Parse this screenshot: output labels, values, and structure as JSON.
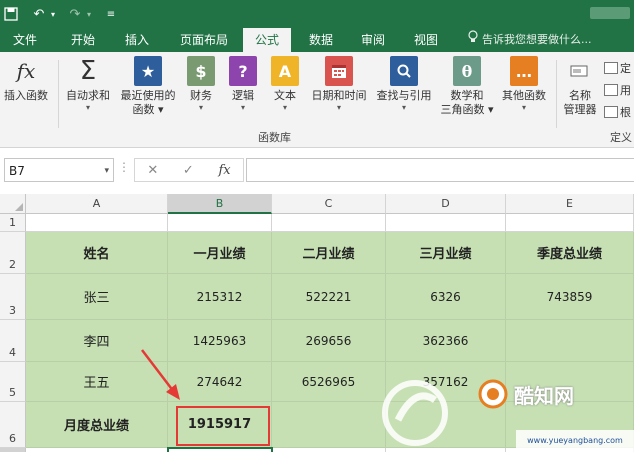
{
  "ribbon": {
    "tabs": [
      "文件",
      "开始",
      "插入",
      "页面布局",
      "公式",
      "数据",
      "审阅",
      "视图"
    ],
    "active_tab": "公式",
    "tell_me": "告诉我您想要做什么...",
    "buttons": {
      "insert_function": "插入函数",
      "autosum": "自动求和",
      "recent_1": "最近使用的",
      "recent_2": "函数",
      "financial": "财务",
      "logical": "逻辑",
      "text": "文本",
      "datetime": "日期和时间",
      "lookup": "查找与引用",
      "math_1": "数学和",
      "math_2": "三角函数",
      "more": "其他函数",
      "name_mgr_1": "名称",
      "name_mgr_2": "管理器",
      "define": "定",
      "use": "用",
      "create": "根"
    },
    "group_label": "函数库",
    "group_label_2": "定义"
  },
  "formula_bar": {
    "name_box": "B7",
    "cancel": "✕",
    "enter": "✓",
    "fx": "fx",
    "formula": ""
  },
  "sheet": {
    "columns": [
      "A",
      "B",
      "C",
      "D",
      "E"
    ],
    "selected_column": "B",
    "rows": [
      "1",
      "2",
      "3",
      "4",
      "5",
      "6"
    ],
    "selected_row": "7",
    "cells": {
      "A2": "姓名",
      "B2": "一月业绩",
      "C2": "二月业绩",
      "D2": "三月业绩",
      "E2": "季度总业绩",
      "A3": "张三",
      "B3": "215312",
      "C3": "522221",
      "D3": "6326",
      "E3": "743859",
      "A4": "李四",
      "B4": "1425963",
      "C4": "269656",
      "D4": "362366",
      "E4": "",
      "A5": "王五",
      "B5": "274642",
      "C5": "6526965",
      "D5": "357162",
      "E5": "",
      "A6": "月度总业绩",
      "B6": "1915917",
      "C6": "",
      "D6": "",
      "E6": ""
    }
  },
  "watermark": {
    "brand": "酷知网",
    "site": "www.yueyangbang.com"
  },
  "colors": {
    "excel_green": "#217346",
    "cell_fill": "#c6e0b4",
    "highlight_red": "#e53935"
  }
}
